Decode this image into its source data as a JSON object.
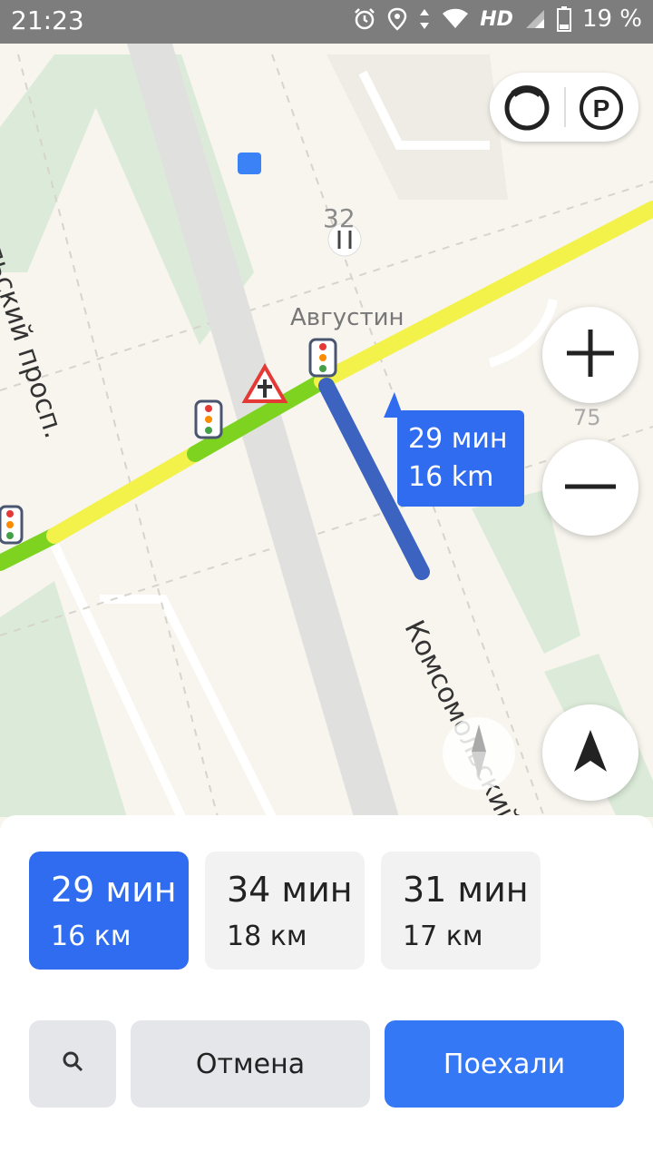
{
  "status_bar": {
    "time": "21:23",
    "network": "HD",
    "battery": "19 %"
  },
  "map": {
    "poi_number": "32",
    "poi_name": "Августин",
    "street_left": "омольский просп.",
    "street_right": "Комсомольский",
    "house_number": "75",
    "route_bubble": {
      "time": "29 мин",
      "distance": "16 km"
    }
  },
  "controls": {
    "zoom_in": "+",
    "zoom_out": "−"
  },
  "route_options": [
    {
      "time": "29 мин",
      "distance": "16 км",
      "selected": true
    },
    {
      "time": "34 мин",
      "distance": "18 км",
      "selected": false
    },
    {
      "time": "31 мин",
      "distance": "17 км",
      "selected": false
    }
  ],
  "actions": {
    "cancel": "Отмена",
    "go": "Поехали"
  },
  "colors": {
    "accent": "#3478f6",
    "route_fast": "#7ed321",
    "route_slow": "#f2f24a",
    "route_selected": "#3c63c0"
  }
}
